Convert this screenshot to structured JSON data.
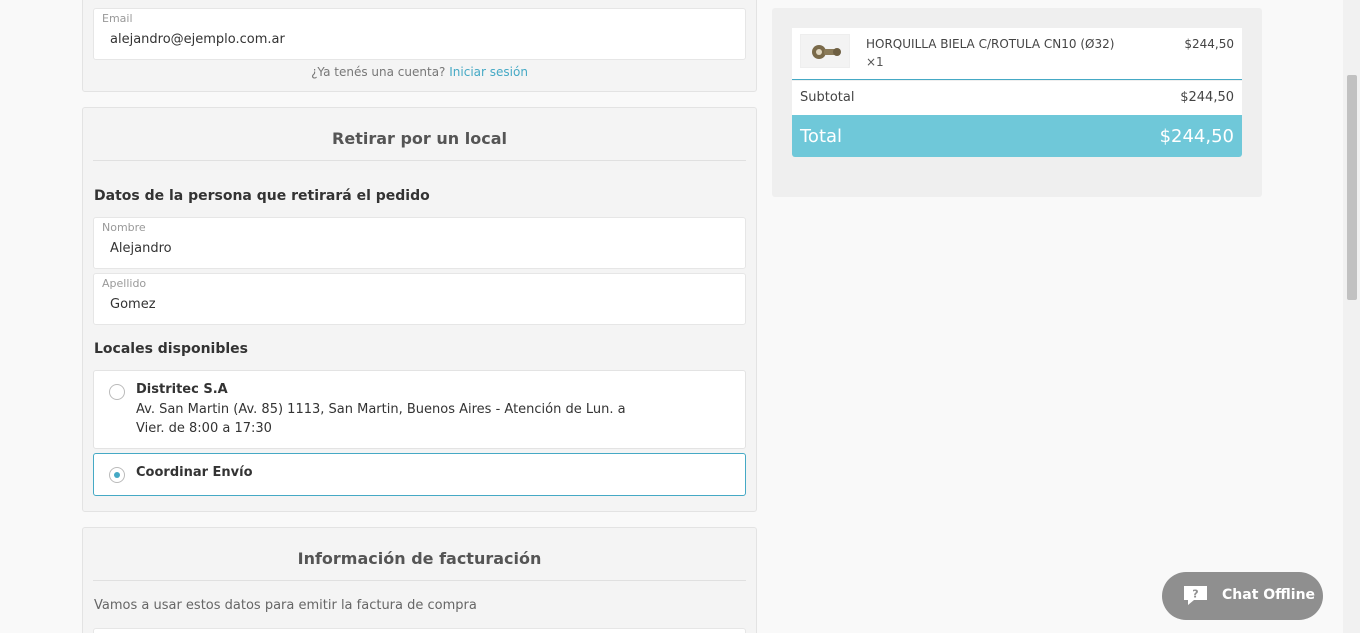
{
  "account": {
    "email_label": "Email",
    "email_value": "alejandro@ejemplo.com.ar",
    "login_prompt": "¿Ya tenés una cuenta?",
    "login_link": "Iniciar sesión"
  },
  "pickup": {
    "title": "Retirar por un local",
    "person_heading": "Datos de la persona que retirará el pedido",
    "first_name_label": "Nombre",
    "first_name_value": "Alejandro",
    "last_name_label": "Apellido",
    "last_name_value": "Gomez",
    "locations_heading": "Locales disponibles",
    "options": [
      {
        "name": "Distritec S.A",
        "description": "Av. San Martin (Av. 85) 1113, San Martin, Buenos Aires - Atención de Lun. a Vier. de 8:00 a 17:30",
        "selected": false
      },
      {
        "name": "Coordinar Envío",
        "description": "",
        "selected": true
      }
    ]
  },
  "billing": {
    "title": "Información de facturación",
    "description": "Vamos a usar estos datos para emitir la factura de compra"
  },
  "summary": {
    "item_name": "HORQUILLA BIELA C/ROTULA CN10 (Ø32)",
    "item_qty": "×1",
    "item_price": "$244,50",
    "subtotal_label": "Subtotal",
    "subtotal_value": "$244,50",
    "total_label": "Total",
    "total_value": "$244,50"
  },
  "chat": {
    "label": "Chat Offline",
    "icon": "chat-question-icon"
  },
  "colors": {
    "accent": "#45a9c5",
    "total_bg": "#6fc8d9",
    "chat_bg": "#8f8f8f"
  }
}
